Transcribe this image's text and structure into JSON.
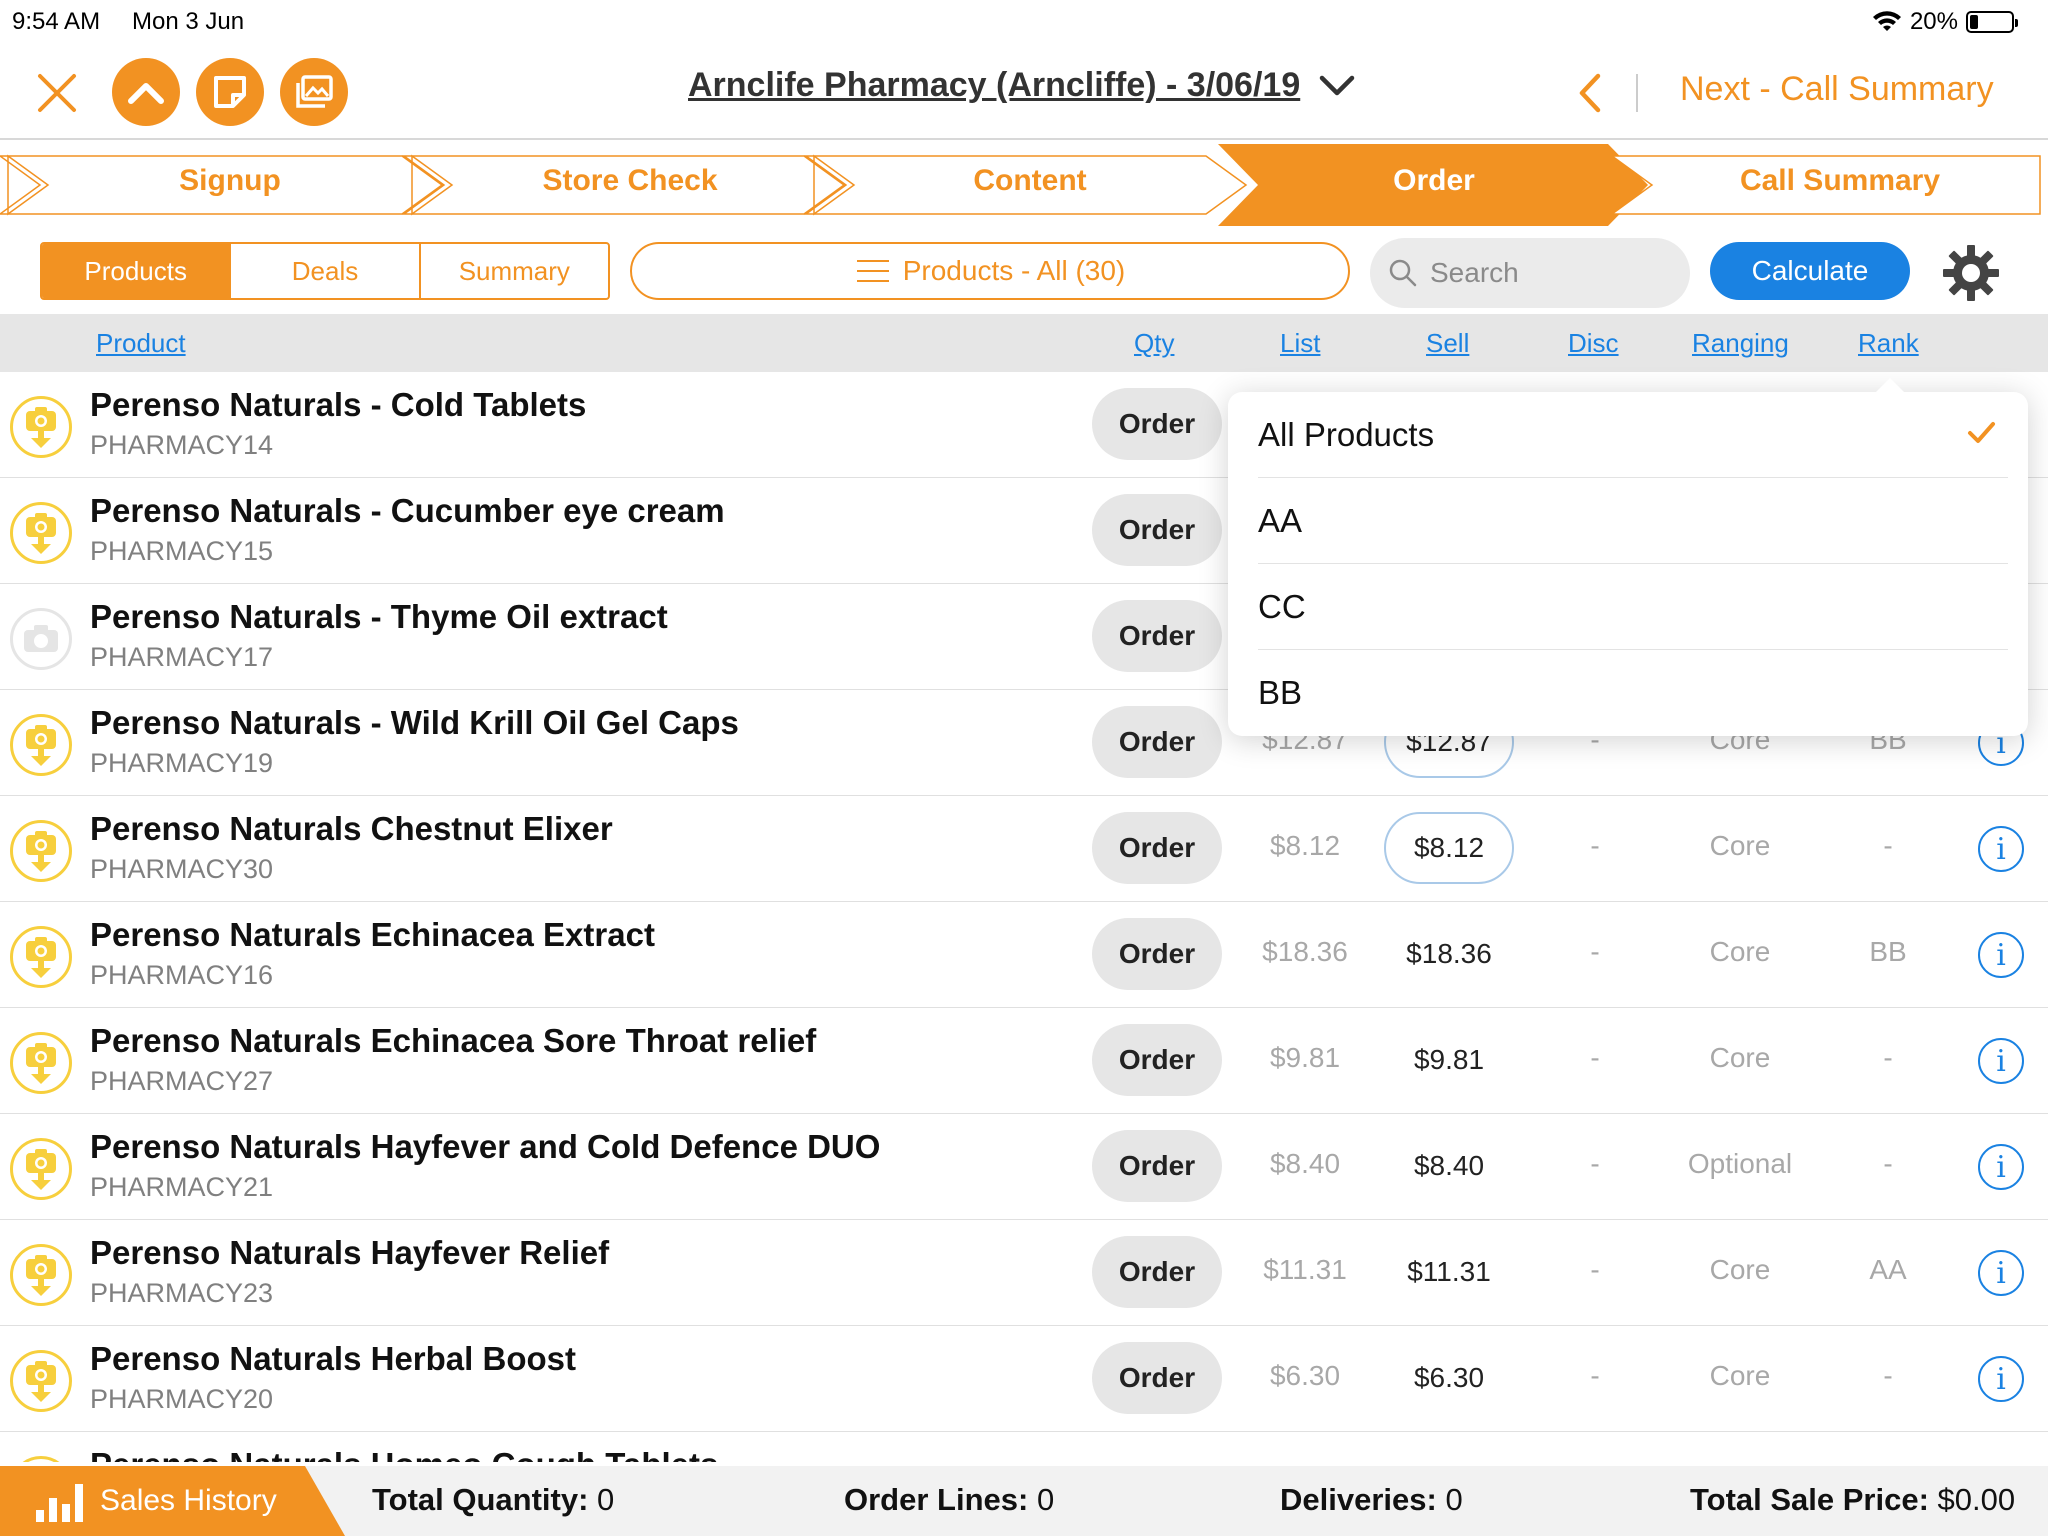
{
  "status": {
    "time": "9:54 AM",
    "date": "Mon 3 Jun",
    "battery": "20%",
    "battery_level": 0.2
  },
  "header": {
    "title": "Arnclife Pharmacy (Arncliffe) - 3/06/19",
    "next_label": "Next - Call Summary"
  },
  "steps": [
    {
      "label": "Signup",
      "active": false
    },
    {
      "label": "Store Check",
      "active": false
    },
    {
      "label": "Content",
      "active": false
    },
    {
      "label": "Order",
      "active": true
    },
    {
      "label": "Call Summary",
      "active": false
    }
  ],
  "toolbar": {
    "tabs": [
      "Products",
      "Deals",
      "Summary"
    ],
    "filter_label": "Products - All (30)",
    "search_placeholder": "Search",
    "calculate_label": "Calculate"
  },
  "columns": {
    "product": "Product",
    "qty": "Qty",
    "list": "List",
    "sell": "Sell",
    "disc": "Disc",
    "ranging": "Ranging",
    "rank": "Rank"
  },
  "rows": [
    {
      "name": "Perenso Naturals - Cold Tablets",
      "code": "PHARMACY14",
      "order": "Order",
      "list": "",
      "sell": "",
      "disc": "",
      "ranging": "",
      "rank": "",
      "has_image": true,
      "sell_boxed": false
    },
    {
      "name": "Perenso Naturals - Cucumber eye cream",
      "code": "PHARMACY15",
      "order": "Order",
      "list": "",
      "sell": "",
      "disc": "",
      "ranging": "",
      "rank": "",
      "has_image": true,
      "sell_boxed": false
    },
    {
      "name": "Perenso Naturals - Thyme Oil extract",
      "code": "PHARMACY17",
      "order": "Order",
      "list": "",
      "sell": "",
      "disc": "",
      "ranging": "",
      "rank": "",
      "has_image": false,
      "sell_boxed": false
    },
    {
      "name": "Perenso Naturals - Wild Krill Oil Gel Caps",
      "code": "PHARMACY19",
      "order": "Order",
      "list": "$12.87",
      "sell": "$12.87",
      "disc": "-",
      "ranging": "Core",
      "rank": "BB",
      "has_image": true,
      "sell_boxed": true
    },
    {
      "name": "Perenso Naturals Chestnut Elixer",
      "code": "PHARMACY30",
      "order": "Order",
      "list": "$8.12",
      "sell": "$8.12",
      "disc": "-",
      "ranging": "Core",
      "rank": "-",
      "has_image": true,
      "sell_boxed": true
    },
    {
      "name": "Perenso Naturals Echinacea Extract",
      "code": "PHARMACY16",
      "order": "Order",
      "list": "$18.36",
      "sell": "$18.36",
      "disc": "-",
      "ranging": "Core",
      "rank": "BB",
      "has_image": true,
      "sell_boxed": false
    },
    {
      "name": "Perenso Naturals Echinacea Sore Throat relief",
      "code": "PHARMACY27",
      "order": "Order",
      "list": "$9.81",
      "sell": "$9.81",
      "disc": "-",
      "ranging": "Core",
      "rank": "-",
      "has_image": true,
      "sell_boxed": false
    },
    {
      "name": "Perenso Naturals Hayfever and Cold Defence DUO",
      "code": "PHARMACY21",
      "order": "Order",
      "list": "$8.40",
      "sell": "$8.40",
      "disc": "-",
      "ranging": "Optional",
      "rank": "-",
      "has_image": true,
      "sell_boxed": false
    },
    {
      "name": "Perenso Naturals Hayfever Relief",
      "code": "PHARMACY23",
      "order": "Order",
      "list": "$11.31",
      "sell": "$11.31",
      "disc": "-",
      "ranging": "Core",
      "rank": "AA",
      "has_image": true,
      "sell_boxed": false
    },
    {
      "name": "Perenso Naturals Herbal Boost",
      "code": "PHARMACY20",
      "order": "Order",
      "list": "$6.30",
      "sell": "$6.30",
      "disc": "-",
      "ranging": "Core",
      "rank": "-",
      "has_image": true,
      "sell_boxed": false
    },
    {
      "name": "Perenso Naturals Homeo Cough Tablets",
      "code": "",
      "order": "",
      "list": "",
      "sell": "",
      "disc": "",
      "ranging": "",
      "rank": "",
      "has_image": true,
      "sell_boxed": false
    }
  ],
  "dropdown": {
    "items": [
      {
        "label": "All Products",
        "selected": true
      },
      {
        "label": "AA",
        "selected": false
      },
      {
        "label": "CC",
        "selected": false
      },
      {
        "label": "BB",
        "selected": false
      }
    ]
  },
  "footer": {
    "sales_history": "Sales History",
    "total_quantity_label": "Total Quantity:",
    "total_quantity": "0",
    "order_lines_label": "Order Lines:",
    "order_lines": "0",
    "deliveries_label": "Deliveries:",
    "deliveries": "0",
    "total_sale_label": "Total Sale Price:",
    "total_sale": "$0.00"
  },
  "colors": {
    "accent": "#f29222",
    "blue": "#1a82e2",
    "yellow": "#f7cf3d"
  }
}
